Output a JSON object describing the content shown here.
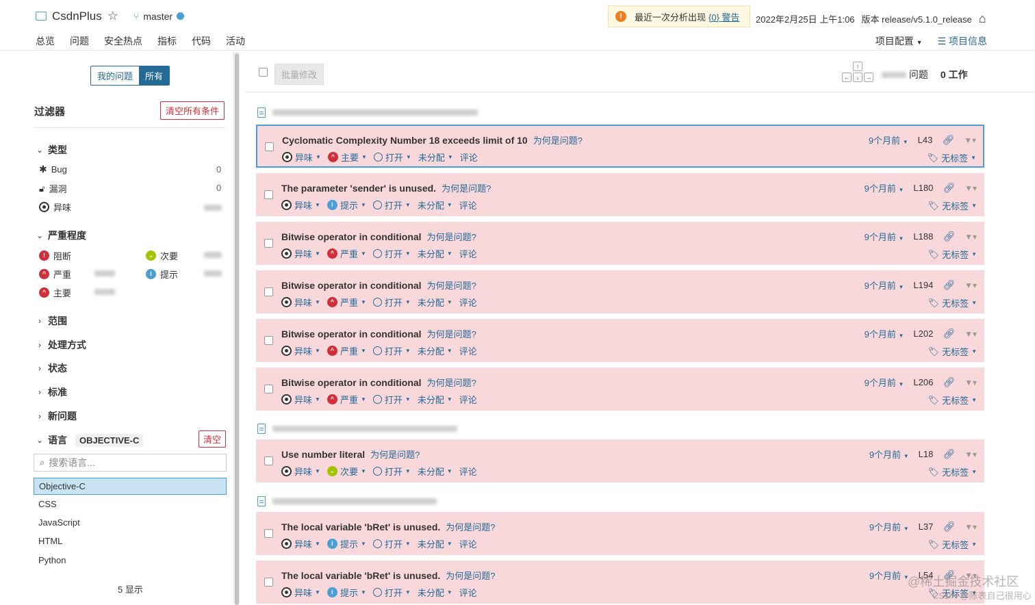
{
  "header": {
    "project_name": "CsdnPlus",
    "branch": "master",
    "warning_text": "最近一次分析出现",
    "warning_link": "{0} 警告",
    "date": "2022年2月25日 上午1:06",
    "version": "版本 release/v5.1.0_release"
  },
  "nav": {
    "tabs": [
      "总览",
      "问题",
      "安全热点",
      "指标",
      "代码",
      "活动"
    ],
    "active": "问题",
    "project_config": "项目配置",
    "project_info": "项目信息"
  },
  "sidebar": {
    "toggle_mine": "我的问题",
    "toggle_all": "所有",
    "filters_title": "过滤器",
    "clear_all": "清空所有条件",
    "type_title": "类型",
    "types": [
      {
        "label": "Bug",
        "count": "0",
        "icon": "bug-icon"
      },
      {
        "label": "漏洞",
        "count": "0",
        "icon": "lock-icon"
      },
      {
        "label": "异味",
        "count": "",
        "icon": "code-smell-icon"
      }
    ],
    "severity_title": "严重程度",
    "severities": [
      {
        "label": "阻断",
        "icon": "blocker-icon",
        "color": "#d02f3a"
      },
      {
        "label": "次要",
        "icon": "minor-icon",
        "color": "#a5c400"
      },
      {
        "label": "严重",
        "icon": "critical-icon",
        "color": "#d02f3a"
      },
      {
        "label": "提示",
        "icon": "info-icon",
        "color": "#4b9fd5"
      },
      {
        "label": "主要",
        "icon": "major-icon",
        "color": "#d02f3a"
      }
    ],
    "collapsed_sections": [
      "范围",
      "处理方式",
      "状态",
      "标准",
      "新问题"
    ],
    "language_title": "语言",
    "language_tag": "OBJECTIVE-C",
    "clear": "清空",
    "search_placeholder": "搜索语言...",
    "languages": [
      "Objective-C",
      "CSS",
      "JavaScript",
      "HTML",
      "Python"
    ],
    "show_count": "5 显示"
  },
  "toolbar": {
    "bulk_change": "批量修改",
    "issues_label": "问题",
    "effort": "0 工作"
  },
  "issue_common": {
    "why": "为何是问题?",
    "type": "异味",
    "status": "打开",
    "assignee": "未分配",
    "comment": "评论",
    "tags": "无标签"
  },
  "issues": [
    {
      "message": "Cyclomatic Complexity Number 18 exceeds limit of 10",
      "severity": "主要",
      "sev_icon": "major-icon",
      "age": "9个月前",
      "line": "L43"
    },
    {
      "message": "The parameter 'sender' is unused.",
      "severity": "提示",
      "sev_icon": "info-icon",
      "age": "9个月前",
      "line": "L180"
    },
    {
      "message": "Bitwise operator in conditional",
      "severity": "严重",
      "sev_icon": "critical-icon",
      "age": "9个月前",
      "line": "L188"
    },
    {
      "message": "Bitwise operator in conditional",
      "severity": "严重",
      "sev_icon": "critical-icon",
      "age": "9个月前",
      "line": "L194"
    },
    {
      "message": "Bitwise operator in conditional",
      "severity": "严重",
      "sev_icon": "critical-icon",
      "age": "9个月前",
      "line": "L202"
    },
    {
      "message": "Bitwise operator in conditional",
      "severity": "严重",
      "sev_icon": "critical-icon",
      "age": "9个月前",
      "line": "L206"
    },
    {
      "message": "Use number literal",
      "severity": "次要",
      "sev_icon": "minor-icon",
      "age": "9个月前",
      "line": "L18"
    },
    {
      "message": "The local variable 'bRet' is unused.",
      "severity": "提示",
      "sev_icon": "info-icon",
      "age": "9个月前",
      "line": "L37"
    },
    {
      "message": "The local variable 'bRet' is unused.",
      "severity": "提示",
      "sev_icon": "info-icon",
      "age": "9个月前",
      "line": "L54"
    }
  ],
  "watermark": {
    "line1": "@稀土掘金技术社区",
    "line2": "CSDN @陈表自己很用心"
  }
}
